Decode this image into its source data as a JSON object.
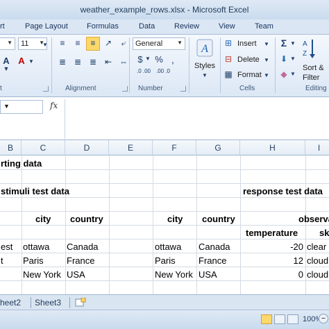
{
  "window": {
    "title": "weather_example_rows.xlsx - Microsoft Excel"
  },
  "tabs": [
    "rt",
    "Page Layout",
    "Formulas",
    "Data",
    "Review",
    "View",
    "Team"
  ],
  "ribbon": {
    "font_size": "11",
    "number_format": "General",
    "currency_symbol": "$",
    "percent_symbol": "%",
    "comma_symbol": ",",
    "dec_inc": ".0 .00",
    "dec_dec": ".00 .0",
    "styles_label": "Styles",
    "insert_label": "Insert",
    "delete_label": "Delete",
    "format_label": "Format",
    "sigma": "Σ",
    "sort_line1": "Sort &",
    "sort_line2": "Filter",
    "groups": {
      "font_tail": "t",
      "alignment": "Alignment",
      "number": "Number",
      "cells": "Cells",
      "editing": "Editing"
    }
  },
  "formula_bar": {
    "fx": "fx",
    "content": ""
  },
  "columns": [
    "B",
    "C",
    "D",
    "E",
    "F",
    "G",
    "H",
    "I"
  ],
  "cells": {
    "r1_b": "rting data",
    "r3_b": "stimuli test data",
    "r3_h": "response test data",
    "r4_c": "city",
    "r4_d": "country",
    "r4_f": "city",
    "r4_g": "country",
    "r4_h": "observa",
    "r5_h": "temperature",
    "r5_i": "sk",
    "r6_b": "est",
    "r6_c": "ottawa",
    "r6_d": "Canada",
    "r6_f": "ottawa",
    "r6_g": "Canada",
    "r6_h": "-20",
    "r6_i": "clear",
    "r7_b": "t",
    "r7_c": "Paris",
    "r7_d": "France",
    "r7_f": "Paris",
    "r7_g": "France",
    "r7_h": "12",
    "r7_i": "cloud",
    "r8_c": "New York",
    "r8_d": "USA",
    "r8_f": "New York",
    "r8_g": "USA",
    "r8_h": "0",
    "r8_i": "cloud"
  },
  "sheets": [
    "heet2",
    "Sheet3"
  ],
  "status": {
    "zoom": "100%",
    "zoom_out": "−"
  },
  "colors": {
    "accent_orange": "#fbd86b",
    "ribbon_blue": "#dce7f5",
    "text_blue": "#1f3b5a"
  }
}
